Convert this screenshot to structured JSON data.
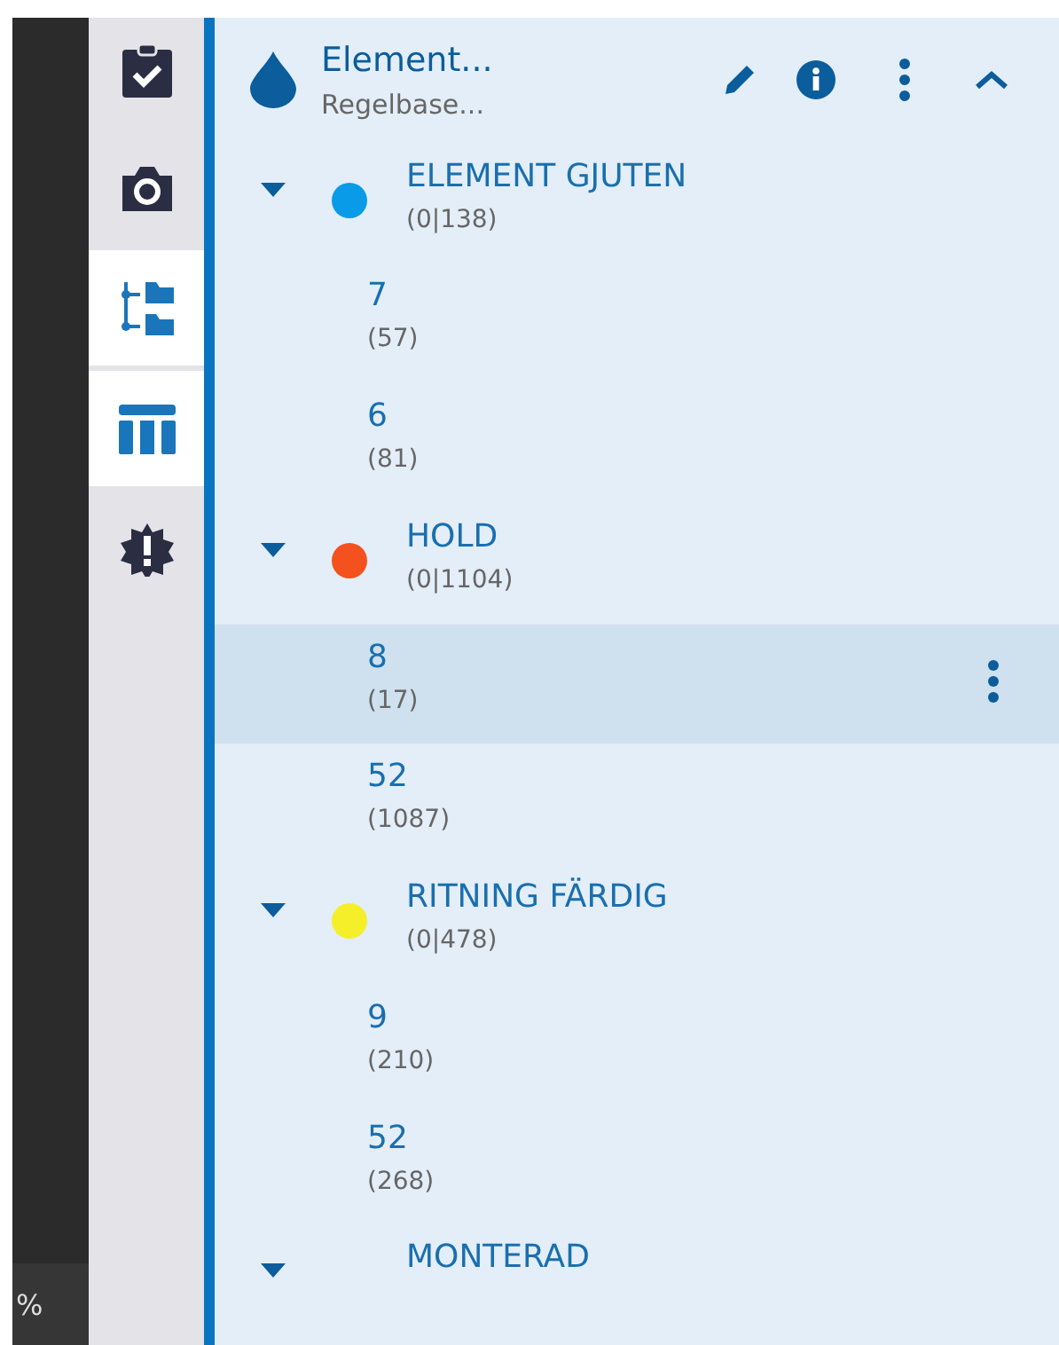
{
  "header": {
    "title": "Element...",
    "subtitle": "Regelbase..."
  },
  "sidebar": {
    "items": [
      {
        "selected": false
      },
      {
        "selected": false
      },
      {
        "selected": true
      },
      {
        "selected": true
      },
      {
        "selected": false
      }
    ]
  },
  "status": {
    "text": "%"
  },
  "groups": [
    {
      "label": "ELEMENT GJUTEN",
      "count": "(0|138)",
      "color": "#0a9be8",
      "expanded": true,
      "children": [
        {
          "label": "7",
          "count": "(57)",
          "selected": false
        },
        {
          "label": "6",
          "count": "(81)",
          "selected": false
        }
      ]
    },
    {
      "label": "HOLD",
      "count": "(0|1104)",
      "color": "#f4511e",
      "expanded": true,
      "children": [
        {
          "label": "8",
          "count": "(17)",
          "selected": true
        },
        {
          "label": "52",
          "count": "(1087)",
          "selected": false
        }
      ]
    },
    {
      "label": "RITNING FÄRDIG",
      "count": "(0|478)",
      "color": "#f5ef2a",
      "expanded": true,
      "children": [
        {
          "label": "9",
          "count": "(210)",
          "selected": false
        },
        {
          "label": "52",
          "count": "(268)",
          "selected": false
        }
      ]
    },
    {
      "label": "MONTERAD",
      "expanded": true
    }
  ]
}
